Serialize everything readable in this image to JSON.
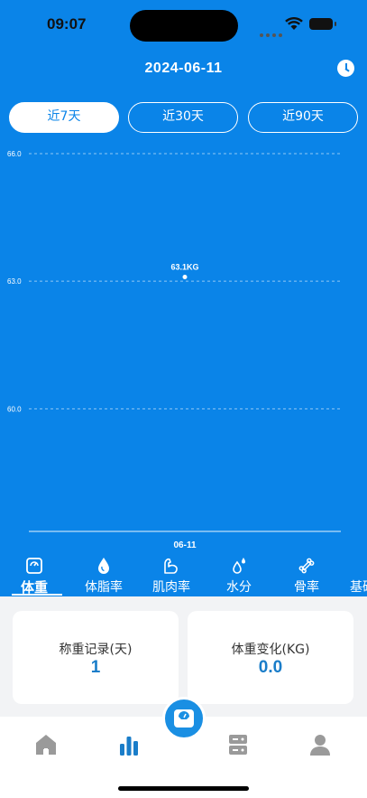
{
  "status_bar": {
    "time": "09:07"
  },
  "header": {
    "date": "2024-06-11",
    "history_icon": "clock-icon"
  },
  "range_tabs": [
    {
      "label": "近7天",
      "active": true
    },
    {
      "label": "近30天",
      "active": false
    },
    {
      "label": "近90天",
      "active": false
    }
  ],
  "chart_data": {
    "type": "scatter",
    "y_ticks": [
      "66.0",
      "63.0",
      "60.0"
    ],
    "ylim": [
      57.5,
      66.0
    ],
    "categories": [
      "06-11"
    ],
    "points": [
      {
        "x": "06-11",
        "y": 63.1,
        "label": "63.1KG"
      }
    ],
    "grid": true
  },
  "metric_tabs": [
    {
      "label": "体重",
      "icon": "scale-icon",
      "active": true
    },
    {
      "label": "体脂率",
      "icon": "drop-icon",
      "active": false
    },
    {
      "label": "肌肉率",
      "icon": "muscle-arm-icon",
      "active": false
    },
    {
      "label": "水分",
      "icon": "water-drops-icon",
      "active": false
    },
    {
      "label": "骨率",
      "icon": "bone-icon",
      "active": false
    },
    {
      "label": "基础",
      "icon": "",
      "active": false
    }
  ],
  "stats": {
    "record_days_label": "称重记录(天)",
    "record_days_value": "1",
    "weight_change_label": "体重变化(KG)",
    "weight_change_value": "0.0"
  },
  "tabbar": {
    "items": [
      {
        "icon": "home-icon",
        "active": false
      },
      {
        "icon": "bar-chart-icon",
        "active": true
      },
      {
        "icon": "server-icon",
        "active": false
      },
      {
        "icon": "person-icon",
        "active": false
      }
    ],
    "center_icon": "scale-icon"
  },
  "colors": {
    "primary": "#0a84e8",
    "accent": "#1a7dc9",
    "inactive": "#9a9a9a"
  }
}
